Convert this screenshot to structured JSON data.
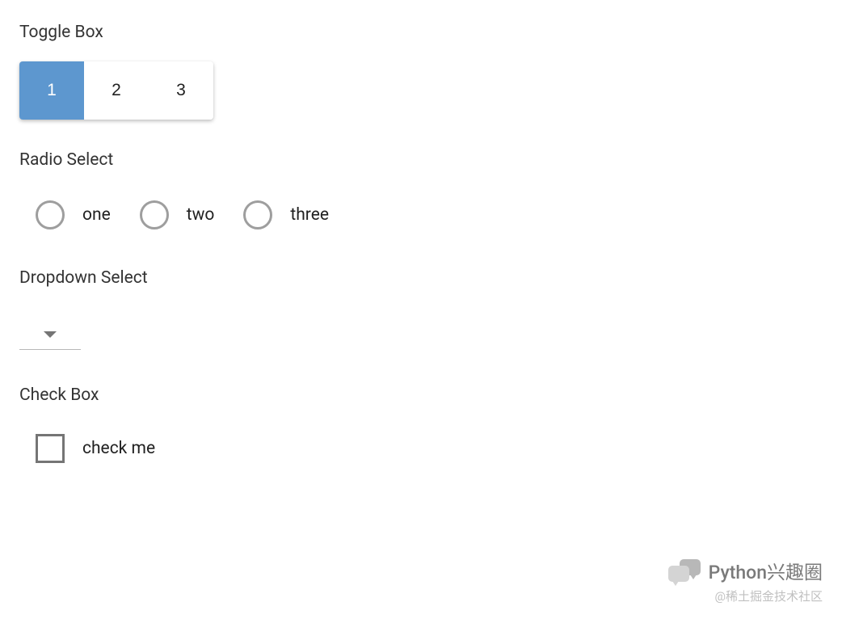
{
  "sections": {
    "toggle": {
      "label": "Toggle Box",
      "options": [
        "1",
        "2",
        "3"
      ],
      "selected_index": 0
    },
    "radio": {
      "label": "Radio Select",
      "options": [
        "one",
        "two",
        "three"
      ]
    },
    "dropdown": {
      "label": "Dropdown Select",
      "selected": ""
    },
    "checkbox": {
      "label": "Check Box",
      "item_label": "check me",
      "checked": false
    }
  },
  "watermark": {
    "main": "Python兴趣圈",
    "sub": "@稀土掘金技术社区"
  }
}
